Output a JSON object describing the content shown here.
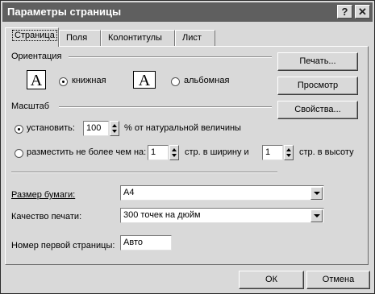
{
  "window": {
    "title": "Параметры страницы",
    "help_glyph": "?",
    "close_glyph": "✕"
  },
  "tabs": [
    {
      "label": "Страница",
      "active": true
    },
    {
      "label": "Поля",
      "active": false
    },
    {
      "label": "Колонтитулы",
      "active": false
    },
    {
      "label": "Лист",
      "active": false
    }
  ],
  "orientation": {
    "label": "Ориентация",
    "icon_glyph": "A",
    "portrait_label": "книжная",
    "landscape_label": "альбомная",
    "selected": "portrait"
  },
  "scale": {
    "label": "Масштаб",
    "set_label": "установить:",
    "set_value": "100",
    "set_suffix": "% от натуральной величины",
    "fit_label": "разместить не более чем на:",
    "fit_width_value": "1",
    "fit_width_suffix": "стр. в ширину и",
    "fit_height_value": "1",
    "fit_height_suffix": "стр. в высоту",
    "selected": "set"
  },
  "paper": {
    "label": "Размер бумаги:",
    "value": "A4"
  },
  "quality": {
    "label": "Качество печати:",
    "value": "300 точек на дюйм"
  },
  "first_page": {
    "label": "Номер первой страницы:",
    "value": "Авто"
  },
  "side_buttons": {
    "print": "Печать...",
    "preview": "Просмотр",
    "properties": "Свойства..."
  },
  "footer_buttons": {
    "ok": "ОК",
    "cancel": "Отмена"
  }
}
